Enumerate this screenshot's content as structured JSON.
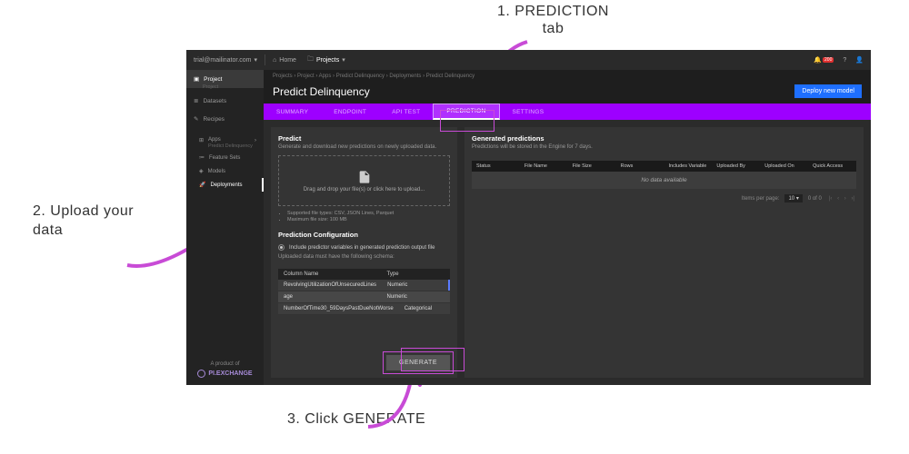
{
  "callouts": {
    "c1_line1": "1. PREDICTION",
    "c1_line2": "tab",
    "c2_line1": "2. Upload your",
    "c2_line2": "data",
    "c3": "3. Click GENERATE"
  },
  "topbar": {
    "user": "trial@mailinator.com",
    "home": "Home",
    "projects": "Projects",
    "badge": "200"
  },
  "sidebar": {
    "project": {
      "label": "Project",
      "sub": "Project"
    },
    "datasets": "Datasets",
    "recipes": "Recipes",
    "apps": {
      "label": "Apps",
      "sub": "Predict Delinquency"
    },
    "feature_sets": "Feature Sets",
    "models": "Models",
    "deployments": "Deployments",
    "footer": {
      "product_of": "A product of",
      "brand": "PI.EXCHANGE"
    }
  },
  "crumbs": "Projects  ›  Project  ›  Apps  ›  Predict Delinquency  ›  Deployments  ›  Predict Delinquency",
  "title": "Predict Delinquency",
  "deploy_btn": "Deploy new model",
  "tabs": [
    "SUMMARY",
    "ENDPOINT",
    "API TEST",
    "PREDICTION",
    "SETTINGS"
  ],
  "predict": {
    "heading": "Predict",
    "hint": "Generate and download new predictions on newly uploaded data.",
    "drop": "Drag and drop your file(s) or click here to upload...",
    "bullets": [
      "Supported file types: CSV, JSON Lines, Parquet",
      "Maximum file size: 100 MB"
    ]
  },
  "config": {
    "heading": "Prediction Configuration",
    "option": "Include predictor variables in generated prediction output file",
    "schema_hint": "Uploaded data must have the following schema:",
    "cols": {
      "name": "Column Name",
      "type": "Type"
    },
    "rows": [
      {
        "name": "RevolvingUtilizationOfUnsecuredLines",
        "type": "Numeric"
      },
      {
        "name": "age",
        "type": "Numeric"
      },
      {
        "name": "NumberOfTime30_59DaysPastDueNotWorse",
        "type": "Categorical"
      }
    ],
    "generate": "GENERATE"
  },
  "generated": {
    "heading": "Generated predictions",
    "hint": "Predictions will be stored in the Engine for 7 days.",
    "cols": [
      "Status",
      "File Name",
      "File Size",
      "Rows",
      "Includes Variable",
      "Uploaded By",
      "Uploaded On",
      "Quick Access"
    ],
    "nodata": "No data available",
    "pager": {
      "ipp": "Items per page:",
      "ipp_val": "10",
      "range": "0 of 0"
    }
  }
}
